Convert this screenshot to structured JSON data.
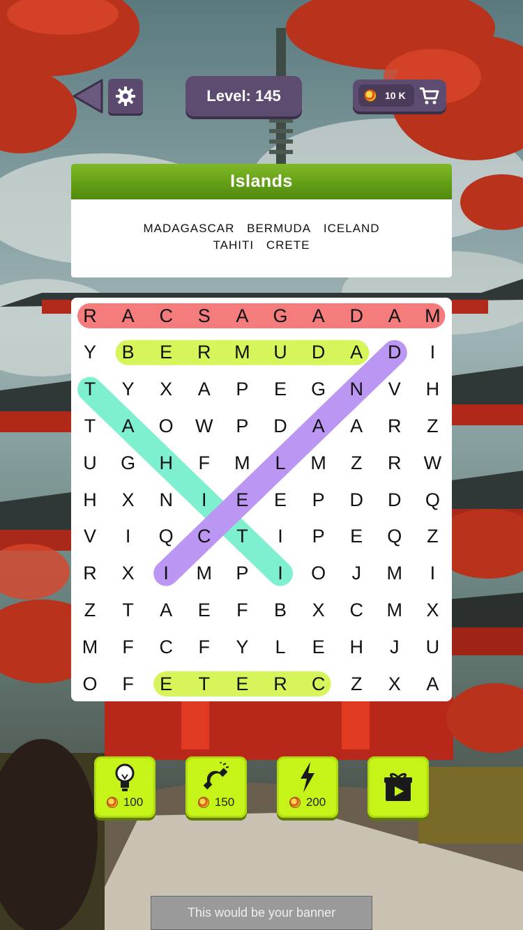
{
  "header": {
    "level_text": "Level: 145",
    "coins_text": "10 K"
  },
  "category": {
    "title": "Islands",
    "words_line1": [
      "MADAGASCAR",
      "BERMUDA",
      "ICELAND"
    ],
    "words_line2": [
      "TAHITI",
      "CRETE"
    ]
  },
  "grid": {
    "rows": [
      "RACSAGADAM",
      "YBERMUDADI",
      "TYXAPEGNVH",
      "TAOWPDAARZ",
      "UGHFMLMZRW",
      "HXNIEEPDDQ",
      "VIQCTIPEQZ",
      "RXIMPIOJMI",
      "ZTAEFBXCMX",
      "MFCFYLEHJU",
      "OFETERCZXA"
    ],
    "found_words": [
      {
        "word": "MADAGASCAR",
        "color": "#f47c7c",
        "from": [
          0,
          0
        ],
        "to": [
          0,
          9
        ]
      },
      {
        "word": "BERMUDA",
        "color": "#d6f55a",
        "from": [
          1,
          1
        ],
        "to": [
          1,
          7
        ]
      },
      {
        "word": "TAHITI",
        "color": "#7ef0d0",
        "from": [
          2,
          0
        ],
        "to": [
          7,
          5
        ]
      },
      {
        "word": "ICELAND",
        "color": "#bb96f2",
        "from": [
          7,
          2
        ],
        "to": [
          1,
          8
        ]
      },
      {
        "word": "CRETE",
        "color": "#d6f55a",
        "from": [
          10,
          2
        ],
        "to": [
          10,
          6
        ]
      }
    ]
  },
  "powerups": [
    {
      "icon": "lightbulb-icon",
      "cost": "100"
    },
    {
      "icon": "magnet-icon",
      "cost": "150"
    },
    {
      "icon": "lightning-icon",
      "cost": "200"
    },
    {
      "icon": "gift-video-icon",
      "cost": ""
    }
  ],
  "banner": {
    "text": "This would be your banner"
  }
}
